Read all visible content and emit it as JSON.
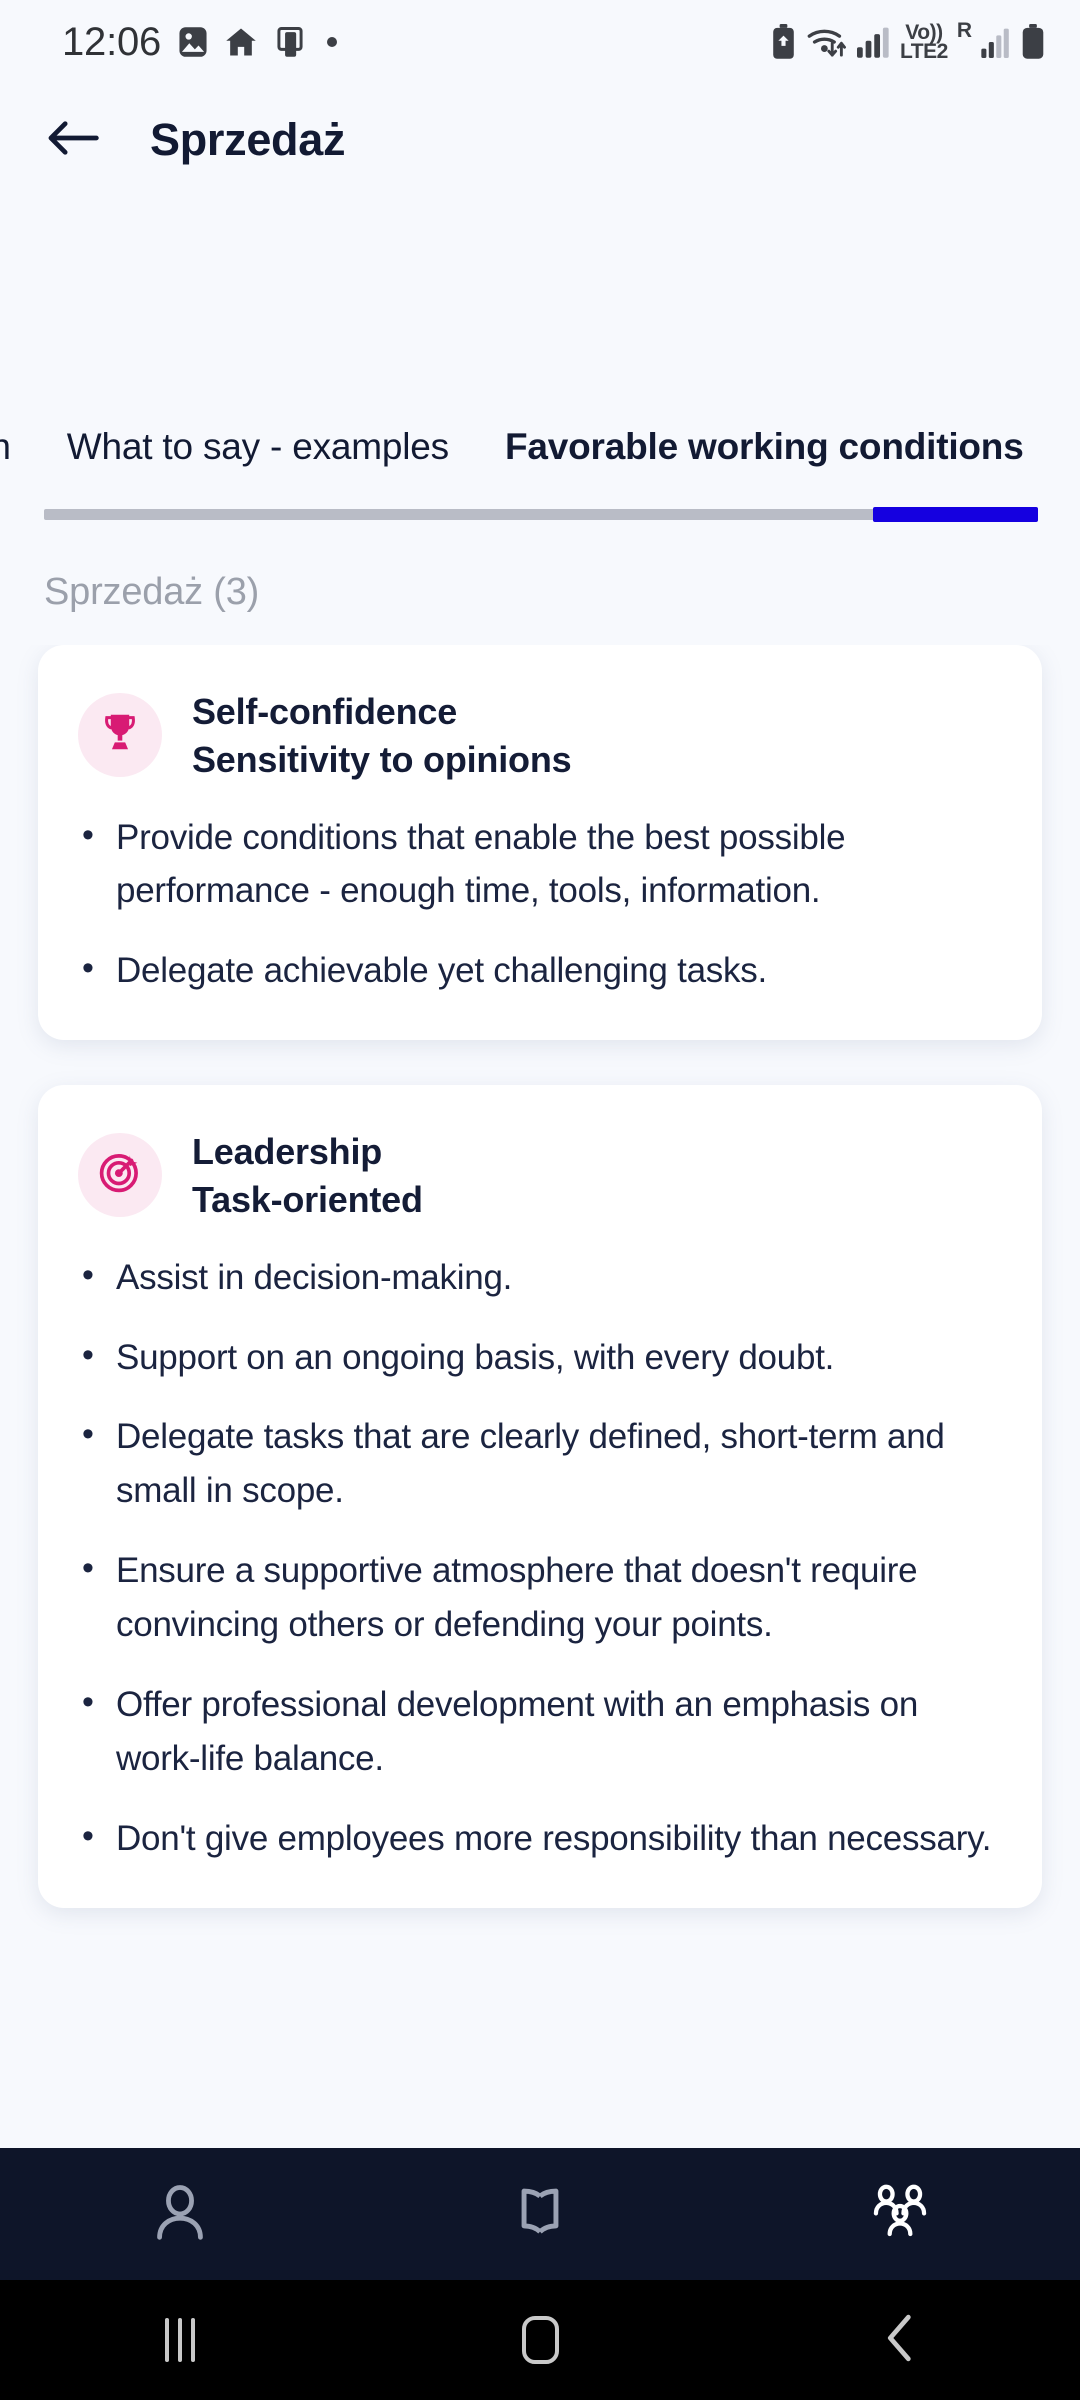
{
  "status_bar": {
    "time": "12:06",
    "left_icons": [
      "image-icon",
      "home-icon",
      "app-window-icon",
      "dot-indicator"
    ],
    "network_label_top": "Vo))",
    "network_label_bottom": "LTE2",
    "roaming_label": "R",
    "right_icons": [
      "battery-saver-icon",
      "wifi-icon",
      "signal-bars-icon",
      "volte-lte2-label",
      "roaming-icon",
      "signal-bars-2-icon",
      "battery-icon"
    ]
  },
  "header": {
    "back_icon": "arrow-left-icon",
    "title": "Sprzedaż"
  },
  "tabs": {
    "items": [
      {
        "label": "on",
        "active": false,
        "clipped": true
      },
      {
        "label": "What to say - examples",
        "active": false,
        "clipped": false
      },
      {
        "label": "Favorable working conditions",
        "active": true,
        "clipped": false
      }
    ]
  },
  "section": {
    "label": "Sprzedaż (3)"
  },
  "cards": [
    {
      "icon": "trophy-icon",
      "title": "Self-confidence",
      "subtitle": "Sensitivity to opinions",
      "bullets": [
        "Provide conditions that enable the best possible performance - enough time, tools, information.",
        "Delegate achievable yet challenging tasks."
      ]
    },
    {
      "icon": "target-icon",
      "title": "Leadership",
      "subtitle": "Task-oriented",
      "bullets": [
        "Assist in decision-making.",
        "Support on an ongoing basis, with every doubt.",
        "Delegate tasks that are clearly defined, short-term and small in scope.",
        "Ensure a supportive atmosphere that doesn't require convincing others or defending your points.",
        "Offer professional development with an emphasis on work-life balance.",
        "Don't give employees more responsibility than necessary."
      ]
    }
  ],
  "bottom_nav": {
    "items": [
      {
        "icon": "person-icon",
        "active": false
      },
      {
        "icon": "book-icon",
        "active": false
      },
      {
        "icon": "group-people-icon",
        "active": true
      }
    ]
  },
  "system_nav": {
    "items": [
      "recents-icon",
      "home-icon",
      "back-icon"
    ]
  },
  "colors": {
    "background": "#f7f9fd",
    "card": "#ffffff",
    "accent_pink": "#d81b74",
    "badge_bg": "#fbe9f2",
    "text_dark": "#121a33",
    "muted": "#9ba0ab",
    "indicator_blue": "#1500e0",
    "nav_bar": "#0e1529"
  }
}
